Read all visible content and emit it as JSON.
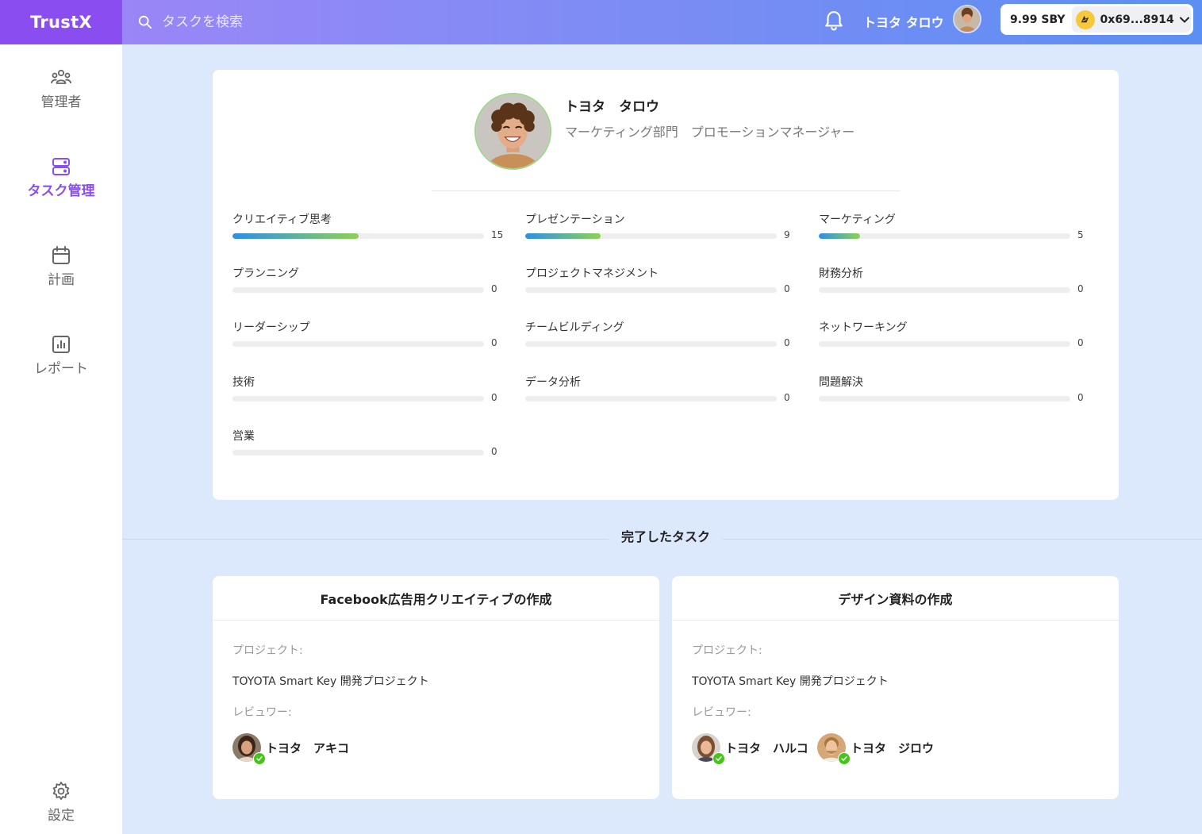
{
  "app": {
    "logo": "TrustX"
  },
  "header": {
    "search_placeholder": "タスクを検索",
    "user_name": "トヨタ タロウ",
    "balance": "9.99 SBY",
    "wallet_address": "0x69...8914"
  },
  "sidebar": {
    "items": [
      {
        "label": "管理者",
        "icon": "users-icon",
        "active": false
      },
      {
        "label": "タスク管理",
        "icon": "server-icon",
        "active": true
      },
      {
        "label": "計画",
        "icon": "calendar-icon",
        "active": false
      },
      {
        "label": "レポート",
        "icon": "chart-icon",
        "active": false
      }
    ],
    "settings_label": "設定"
  },
  "profile": {
    "name": "トヨタ　タロウ",
    "role": "マーケティング部門　プロモーションマネージャー",
    "skills": [
      {
        "label": "クリエイティブ思考",
        "value": 15,
        "progress": 0.5
      },
      {
        "label": "プレゼンテーション",
        "value": 9,
        "progress": 0.3
      },
      {
        "label": "マーケティング",
        "value": 5,
        "progress": 0.165
      },
      {
        "label": "プランニング",
        "value": 0,
        "progress": 0
      },
      {
        "label": "プロジェクトマネジメント",
        "value": 0,
        "progress": 0
      },
      {
        "label": "財務分析",
        "value": 0,
        "progress": 0
      },
      {
        "label": "リーダーシップ",
        "value": 0,
        "progress": 0
      },
      {
        "label": "チームビルディング",
        "value": 0,
        "progress": 0
      },
      {
        "label": "ネットワーキング",
        "value": 0,
        "progress": 0
      },
      {
        "label": "技術",
        "value": 0,
        "progress": 0
      },
      {
        "label": "データ分析",
        "value": 0,
        "progress": 0
      },
      {
        "label": "問題解決",
        "value": 0,
        "progress": 0
      },
      {
        "label": "営業",
        "value": 0,
        "progress": 0
      }
    ]
  },
  "completed": {
    "title": "完了したタスク",
    "tasks": [
      {
        "title": "Facebook広告用クリエイティブの作成",
        "project_label": "プロジェクト:",
        "project": "TOYOTA Smart Key 開発プロジェクト",
        "reviewer_label": "レビュワー:",
        "reviewers": [
          {
            "name": "トヨタ　アキコ"
          }
        ]
      },
      {
        "title": "デザイン資料の作成",
        "project_label": "プロジェクト:",
        "project": "TOYOTA Smart Key 開発プロジェクト",
        "reviewer_label": "レビュワー:",
        "reviewers": [
          {
            "name": "トヨタ　ハルコ"
          },
          {
            "name": "トヨタ　ジロウ"
          }
        ]
      }
    ]
  },
  "colors": {
    "brand": "#8a4ef0",
    "progress_start": "#2e8fe6",
    "progress_end": "#8ed255",
    "check": "#45c41a",
    "page_bg": "#dce8fb"
  }
}
